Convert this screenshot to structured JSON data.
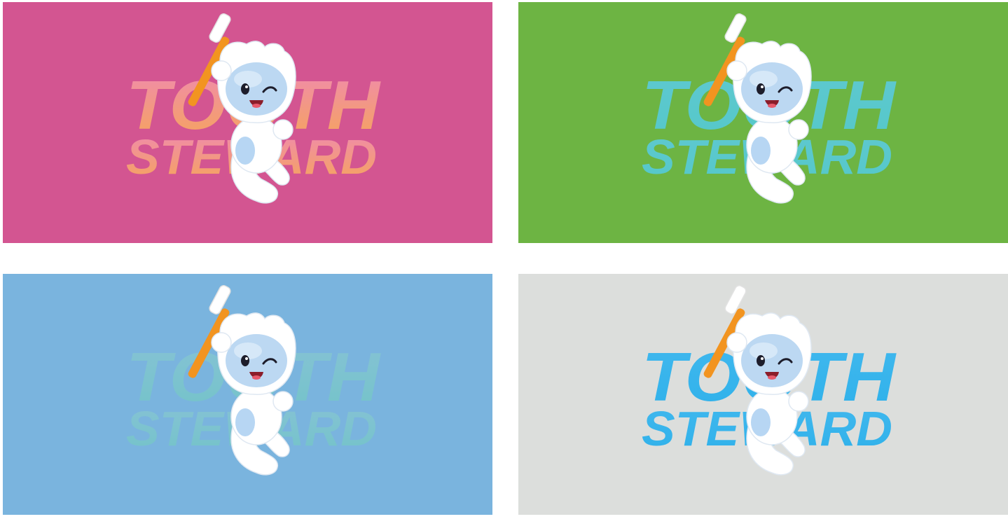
{
  "logo": {
    "line1": "TOOTH",
    "line2": "STEWARD"
  },
  "panels": [
    {
      "id": "pink",
      "background": "#d35591",
      "text_colors": [
        "#f08ab0",
        "#f5a55a"
      ],
      "text_opacity": 1
    },
    {
      "id": "green",
      "background": "#6db443",
      "text_colors": [
        "#5ec9d0",
        "#55c7c9"
      ],
      "text_opacity": 1
    },
    {
      "id": "blue",
      "background": "#7ab4de",
      "text_colors": [
        "#90cfcf",
        "#6fd1b8"
      ],
      "text_opacity": 0.55
    },
    {
      "id": "gray",
      "background": "#dcdedc",
      "text_colors": [
        "#41b8ee",
        "#2fb1ea"
      ],
      "text_opacity": 1
    }
  ]
}
